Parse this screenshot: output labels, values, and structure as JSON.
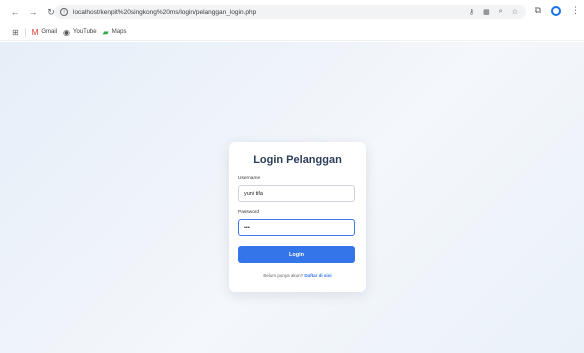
{
  "browser": {
    "url": "localhost/kenpit%20singkong%20ms/login/pelanggan_login.php",
    "bookmarks": [
      {
        "label": "Gmail",
        "icon": "gmail-icon"
      },
      {
        "label": "YouTube",
        "icon": "youtube-icon"
      },
      {
        "label": "Maps",
        "icon": "maps-icon"
      }
    ]
  },
  "login": {
    "title": "Login Pelanggan",
    "username_label": "Username",
    "username_value": "yuni tifa",
    "password_label": "Password",
    "password_value": "•••",
    "button_label": "Login",
    "footer_text": "Belum punya akun?",
    "register_link": "Daftar di sini"
  },
  "colors": {
    "accent": "#3476ea",
    "title": "#2c3e5a",
    "background": "#eaf0f8"
  }
}
